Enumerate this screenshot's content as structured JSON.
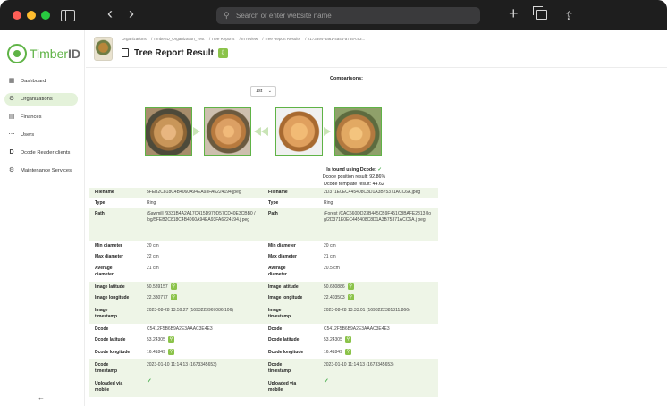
{
  "browser": {
    "url_placeholder": "Search or enter website name"
  },
  "sidebar": {
    "logo_text_green": "Timber",
    "logo_text_gray": "ID",
    "items": [
      {
        "label": "Dashboard",
        "icon": "dashboard-icon"
      },
      {
        "label": "Organizations",
        "icon": "organizations-icon"
      },
      {
        "label": "Finances",
        "icon": "finances-icon"
      },
      {
        "label": "Users",
        "icon": "users-icon"
      },
      {
        "label": "Dcode Reader clients",
        "icon": "dcode-reader-icon"
      },
      {
        "label": "Maintenance Services",
        "icon": "maintenance-icon"
      }
    ],
    "active_index": 1,
    "collapse_arrow": "←"
  },
  "header": {
    "breadcrumb": [
      "Organizations",
      "/ TimberID_Organization_Test",
      "/ Tree Reports",
      "/ In review",
      "/ Tree Report Results",
      "/ 2173394-6a61-4a44-a785-c93..."
    ],
    "title": "Tree Report Result"
  },
  "comparisons": {
    "label": "Comparisons:",
    "selected": "1st"
  },
  "found": {
    "label": "Is found using Dcode:",
    "position_result": "Dcode position result: 92.86%",
    "template_result": "Dcode template result: 44.62"
  },
  "table": {
    "rows": [
      {
        "label": "Filename",
        "left": "5FEB2C818C4B4060A94EA93FA6224194.jpeg",
        "right": "2D371E0EC445408C8D1A3B75371ACC6A.jpeg"
      },
      {
        "label": "Type",
        "left": "Ring",
        "right": "Ring"
      },
      {
        "label": "Path",
        "left": "/Sawmill /9331B4A2A17C415D979D57CD40E3CBB0 /log/5FEB2C818C4B4060A94EA93FA6224194.j peg",
        "right": "/Forest /CAC660DD23B445CB9F451C8BAFE2813 /log/2D371E0EC445408C8D1A3B75371ACC6A.j peg"
      },
      {
        "label": "Min diameter",
        "left": "20 cm",
        "right": "20 cm"
      },
      {
        "label": "Max diameter",
        "left": "22 cm",
        "right": "21 cm"
      },
      {
        "label": "Average diameter",
        "left": "21 cm",
        "right": "20.5 cm"
      },
      {
        "label": "Image latitude",
        "left": "50.589157",
        "right": "50.630886"
      },
      {
        "label": "Image longitude",
        "left": "22.380777",
        "right": "22.403503"
      },
      {
        "label": "Image timestamp",
        "left": "2023-08-28 13:59:27 (1693223967086.106)",
        "right": "2023-08-28 13:33:01 (1693222381311.866)"
      },
      {
        "label": "Dcode",
        "left": "C5412F5B6B9A2E3AAAC3E4E3",
        "right": "C5412F5B6B9A2E3AAAC3E4E3"
      },
      {
        "label": "Dcode latitude",
        "left": "53.24305",
        "right": "53.24305"
      },
      {
        "label": "Dcode longitude",
        "left": "16.41849",
        "right": "16.41849"
      },
      {
        "label": "Dcode timestamp",
        "left": "2023-01-10 11:14:13 (1673345653)",
        "right": "2023-01-10 11:14:13 (1673345653)"
      },
      {
        "label": "Uploaded via mobile",
        "left": "✓",
        "right": "✓"
      }
    ]
  },
  "colors": {
    "accent": "#8bc34a",
    "brand": "#5fb346",
    "row_highlight": "#eef5e7"
  }
}
